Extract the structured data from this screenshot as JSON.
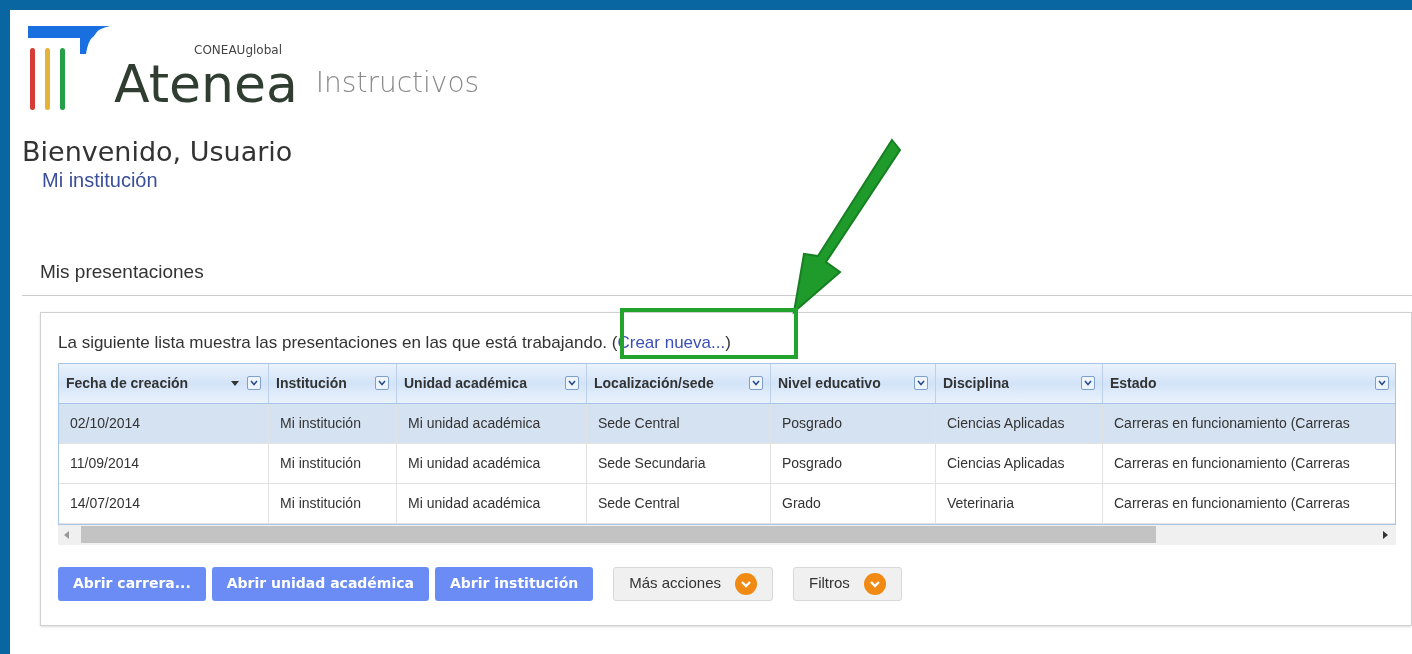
{
  "header": {
    "brand_small": "CONEAUglobal",
    "brand": "Atenea",
    "subtitle": "Instructivos"
  },
  "greeting": "Bienvenido, Usuario",
  "institution_link": "Mi institución",
  "section_title": "Mis presentaciones",
  "intro": {
    "before": "La siguiente lista muestra las presentaciones en las que está trabajando. (",
    "link": "Crear nueva...",
    "after": ")"
  },
  "table": {
    "columns": [
      {
        "label": "Fecha de creación",
        "sorted": true
      },
      {
        "label": "Institución",
        "sorted": false
      },
      {
        "label": "Unidad académica",
        "sorted": false
      },
      {
        "label": "Localización/sede",
        "sorted": false
      },
      {
        "label": "Nivel educativo",
        "sorted": false
      },
      {
        "label": "Disciplina",
        "sorted": false
      },
      {
        "label": "Estado",
        "sorted": false
      }
    ],
    "rows": [
      {
        "selected": true,
        "cells": [
          "02/10/2014",
          "Mi institución",
          "Mi unidad académica",
          "Sede Central",
          "Posgrado",
          "Ciencias Aplicadas",
          "Carreras en funcionamiento (Carreras"
        ]
      },
      {
        "selected": false,
        "cells": [
          "11/09/2014",
          "Mi institución",
          "Mi unidad académica",
          "Sede Secundaria",
          "Posgrado",
          "Ciencias Aplicadas",
          "Carreras en funcionamiento (Carreras"
        ]
      },
      {
        "selected": false,
        "cells": [
          "14/07/2014",
          "Mi institución",
          "Mi unidad académica",
          "Sede Central",
          "Grado",
          "Veterinaria",
          "Carreras en funcionamiento (Carreras"
        ]
      }
    ]
  },
  "buttons": [
    {
      "label": "Abrir carrera...",
      "kind": "primary"
    },
    {
      "label": "Abrir unidad académica",
      "kind": "primary"
    },
    {
      "label": "Abrir institución",
      "kind": "primary"
    },
    {
      "label": "Más acciones",
      "kind": "menu"
    },
    {
      "label": "Filtros",
      "kind": "menu"
    }
  ]
}
